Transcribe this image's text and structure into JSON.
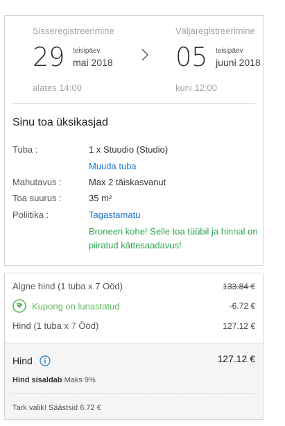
{
  "checkin": {
    "label": "Sisseregistreerimine",
    "day": "29",
    "weekday": "teisipäev",
    "month": "mai 2018",
    "time": "alates 14:00"
  },
  "checkout": {
    "label": "Väljaregistreerimine",
    "day": "05",
    "weekday": "teisipäev",
    "month": "juuni 2018",
    "time": "kuni 12:00"
  },
  "icons": {
    "between_dates": "chevron-right-icon",
    "coupon": "tag-icon",
    "price_info": "info-icon"
  },
  "room": {
    "title": "Sinu toa üksikasjad",
    "room_label": "Tuba :",
    "room_value": "1 x Stuudio (Studio)",
    "change_link": "Muuda tuba",
    "capacity_label": "Mahutavus :",
    "capacity_value": "Max 2 täiskasvanut",
    "size_label": "Toa suurus :",
    "size_value": "35 m²",
    "policy_label": "Poliitika :",
    "policy_value": "Tagastamatu",
    "promo": "Broneeri kohe! Selle toa tüübil ja hinnal on piiratud kättesaadavus!"
  },
  "price": {
    "original_label": "Algne hind (1 tuba x 7 Ööd)",
    "original_amount": "133.84 €",
    "coupon_label": "Kupong on lunastatud",
    "coupon_amount": "-6.72 €",
    "price_label": "Hind (1 tuba x 7 Ööd)",
    "price_amount": "127.12 €",
    "total_label": "Hind",
    "total_amount": "127.12 €",
    "tax_bold": "Hind sisaldab",
    "tax_rest": "Maks 9%",
    "savings": "Tark valik! Säästsid 6.72 €"
  },
  "colors": {
    "link": "#1a75cf",
    "success": "#2fa34a",
    "coupon": "#5cb85c",
    "border": "#d4d4d4"
  }
}
